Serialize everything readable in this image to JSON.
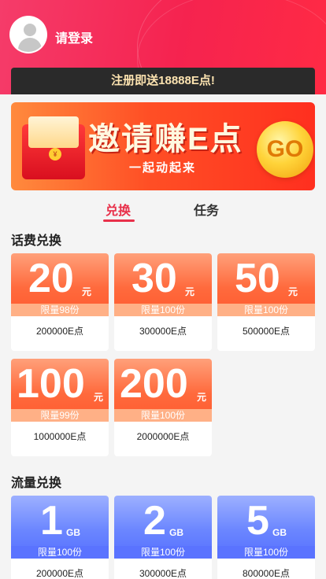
{
  "header": {
    "login_label": "请登录"
  },
  "notice": {
    "text": "注册即送18888E点!"
  },
  "banner": {
    "title": "邀请赚E点",
    "subtitle": "一起动起来",
    "go_label": "GO",
    "coin_symbol": "¥"
  },
  "tabs": [
    {
      "label": "兑换",
      "active": true
    },
    {
      "label": "任务",
      "active": false
    }
  ],
  "phone_section": {
    "title": "话费兑换",
    "items": [
      {
        "amount": "20",
        "unit": "元",
        "limit": "限量98份",
        "price": "200000E点"
      },
      {
        "amount": "30",
        "unit": "元",
        "limit": "限量100份",
        "price": "300000E点"
      },
      {
        "amount": "50",
        "unit": "元",
        "limit": "限量100份",
        "price": "500000E点"
      },
      {
        "amount": "100",
        "unit": "元",
        "limit": "限量99份",
        "price": "1000000E点"
      },
      {
        "amount": "200",
        "unit": "元",
        "limit": "限量100份",
        "price": "2000000E点"
      }
    ]
  },
  "data_section": {
    "title": "流量兑换",
    "items": [
      {
        "amount": "1",
        "unit": "GB",
        "limit": "限量100份",
        "price": "200000E点"
      },
      {
        "amount": "2",
        "unit": "GB",
        "limit": "限量100份",
        "price": "300000E点"
      },
      {
        "amount": "5",
        "unit": "GB",
        "limit": "限量100份",
        "price": "800000E点"
      }
    ]
  },
  "colors": {
    "accent": "#e8304a",
    "header": "#f5234f",
    "phone_card": "#ff6a3d",
    "data_card": "#6b86ff",
    "notice_bg": "#2a2a2a",
    "notice_text": "#fce3b0"
  }
}
